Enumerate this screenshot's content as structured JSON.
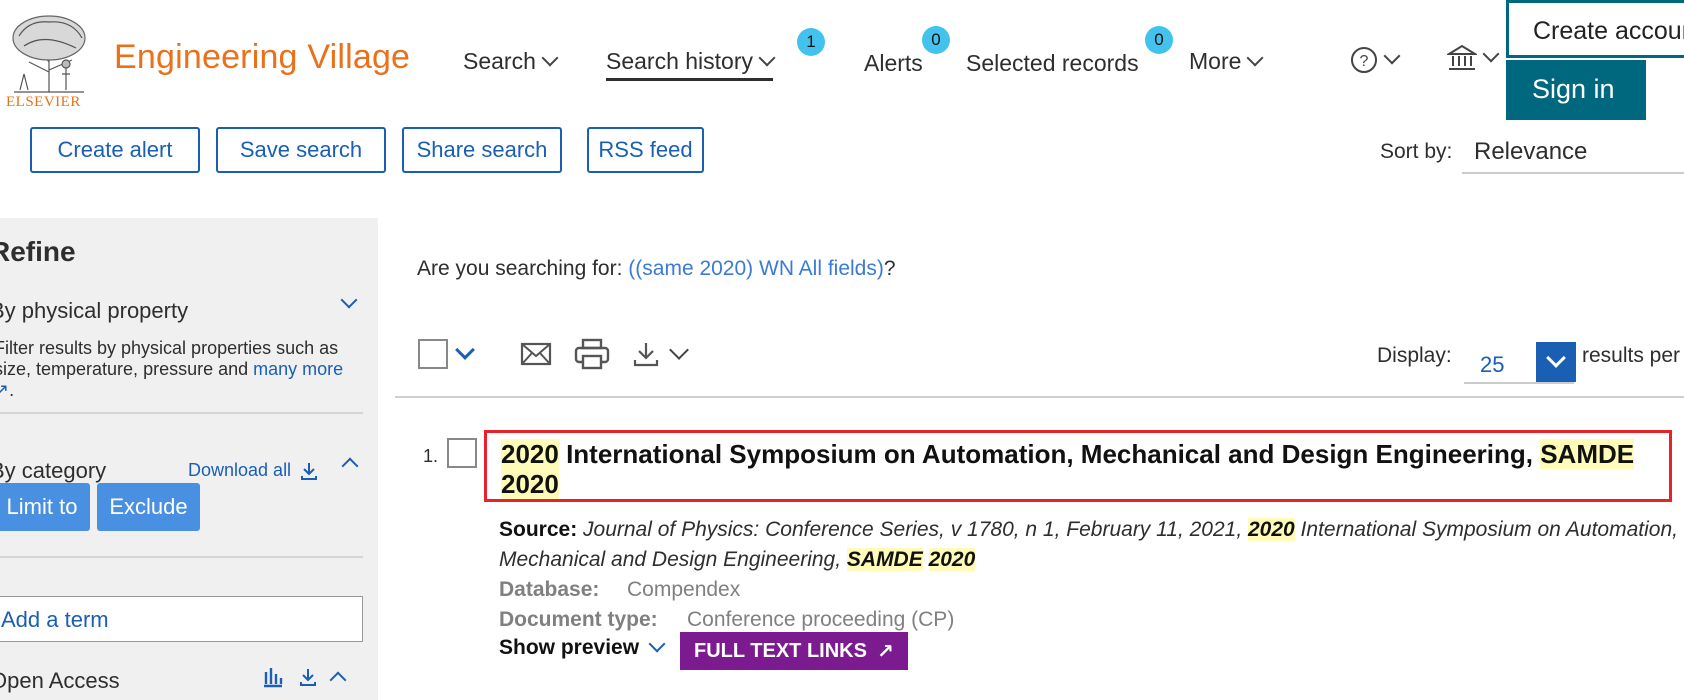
{
  "header": {
    "publisher": "ELSEVIER",
    "brand": "Engineering Village",
    "nav": [
      {
        "label": "Search"
      },
      {
        "label": "Search history",
        "badge": "1"
      },
      {
        "label": "Alerts",
        "badge": "0"
      },
      {
        "label": "Selected records",
        "badge": "0"
      },
      {
        "label": "More"
      }
    ],
    "create_account": "Create account",
    "sign_in": "Sign in"
  },
  "toolbar": {
    "create_alert": "Create alert",
    "save_search": "Save search",
    "share_search": "Share search",
    "rss_feed": "RSS feed",
    "sort_label": "Sort by:",
    "sort_value": "Relevance"
  },
  "sidebar": {
    "title": "Refine",
    "physical_property": {
      "title": "By physical property",
      "desc_line1": "Filter results by physical properties such as",
      "desc_line2": "size, temperature, pressure and",
      "desc_link": "many more",
      "desc_tail": "."
    },
    "category": {
      "title": "By category",
      "download_all": "Download all",
      "limit_to": "Limit to",
      "exclude": "Exclude",
      "add_term_placeholder": "Add a term"
    },
    "open_access": {
      "title": "Open Access"
    }
  },
  "main": {
    "suggest_prefix": "Are you searching for: ",
    "suggest_link": "((same 2020) WN All fields)",
    "suggest_suffix": "?",
    "display_label": "Display:",
    "display_value": "25",
    "per_page": "results per page",
    "results": [
      {
        "number": "1.",
        "title_parts": [
          {
            "text": "2020",
            "hl": true
          },
          {
            "text": " International Symposium on Automation, Mechanical and Design Engineering, ",
            "hl": false
          },
          {
            "text": "SAMDE",
            "hl": true
          },
          {
            "text": " ",
            "hl": false
          },
          {
            "text": "2020",
            "hl": true
          }
        ],
        "source_label": "Source:",
        "source_text": " Journal of Physics: Conference Series, v 1780, n 1, February 11, 2021, ",
        "source_hl1": "2020",
        "source_mid": " International Symposium on Automation, Mechanical and Design Engineering, ",
        "source_hl2": "SAMDE",
        "source_hl3": "2020",
        "database_label": "Database:",
        "database_value": "Compendex",
        "doctype_label": "Document type:",
        "doctype_value": "Conference proceeding (CP)",
        "show_preview": "Show preview",
        "full_text_links": "FULL TEXT LINKS"
      }
    ]
  },
  "colors": {
    "brand_orange": "#e9711c",
    "link_blue": "#1a5fb4",
    "teal": "#00687e",
    "badge": "#44c2ee",
    "highlight": "#fefcb8",
    "annotation_red": "#e8222b",
    "ftl_purple": "#7c1b8f"
  }
}
